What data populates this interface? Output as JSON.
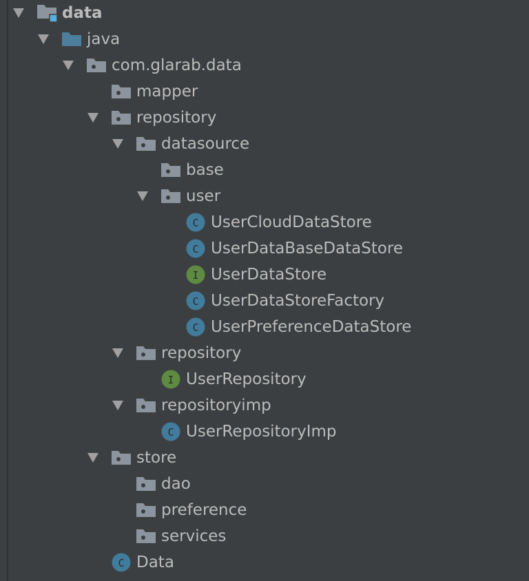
{
  "colors": {
    "background": "#3c3f41",
    "text": "#bbbbbb",
    "folder": "#8c959e",
    "source_folder": "#4b7f9c",
    "class": "#417c9c",
    "interface": "#5e8a41",
    "module_badge": "#53b0e0"
  },
  "tree": [
    {
      "label": "data",
      "level": 0,
      "type": "module",
      "expanded": true
    },
    {
      "label": "java",
      "level": 1,
      "type": "source-folder",
      "expanded": true
    },
    {
      "label": "com.glarab.data",
      "level": 2,
      "type": "package",
      "expanded": true
    },
    {
      "label": "mapper",
      "level": 3,
      "type": "package",
      "expanded": false
    },
    {
      "label": "repository",
      "level": 3,
      "type": "package",
      "expanded": true
    },
    {
      "label": "datasource",
      "level": 4,
      "type": "package",
      "expanded": true
    },
    {
      "label": "base",
      "level": 5,
      "type": "package",
      "expanded": false
    },
    {
      "label": "user",
      "level": 5,
      "type": "package",
      "expanded": true
    },
    {
      "label": "UserCloudDataStore",
      "level": 6,
      "type": "class",
      "badge": "C"
    },
    {
      "label": "UserDataBaseDataStore",
      "level": 6,
      "type": "class",
      "badge": "C"
    },
    {
      "label": "UserDataStore",
      "level": 6,
      "type": "interface",
      "badge": "I"
    },
    {
      "label": "UserDataStoreFactory",
      "level": 6,
      "type": "class",
      "badge": "C"
    },
    {
      "label": "UserPreferenceDataStore",
      "level": 6,
      "type": "class",
      "badge": "C"
    },
    {
      "label": "repository",
      "level": 4,
      "type": "package",
      "expanded": true
    },
    {
      "label": "UserRepository",
      "level": 5,
      "type": "interface",
      "badge": "I"
    },
    {
      "label": "repositoryimp",
      "level": 4,
      "type": "package",
      "expanded": true
    },
    {
      "label": "UserRepositoryImp",
      "level": 5,
      "type": "class",
      "badge": "C"
    },
    {
      "label": "store",
      "level": 3,
      "type": "package",
      "expanded": true
    },
    {
      "label": "dao",
      "level": 4,
      "type": "package",
      "expanded": false
    },
    {
      "label": "preference",
      "level": 4,
      "type": "package",
      "expanded": false
    },
    {
      "label": "services",
      "level": 4,
      "type": "package",
      "expanded": false
    },
    {
      "label": "Data",
      "level": 3,
      "type": "class",
      "badge": "C"
    }
  ]
}
